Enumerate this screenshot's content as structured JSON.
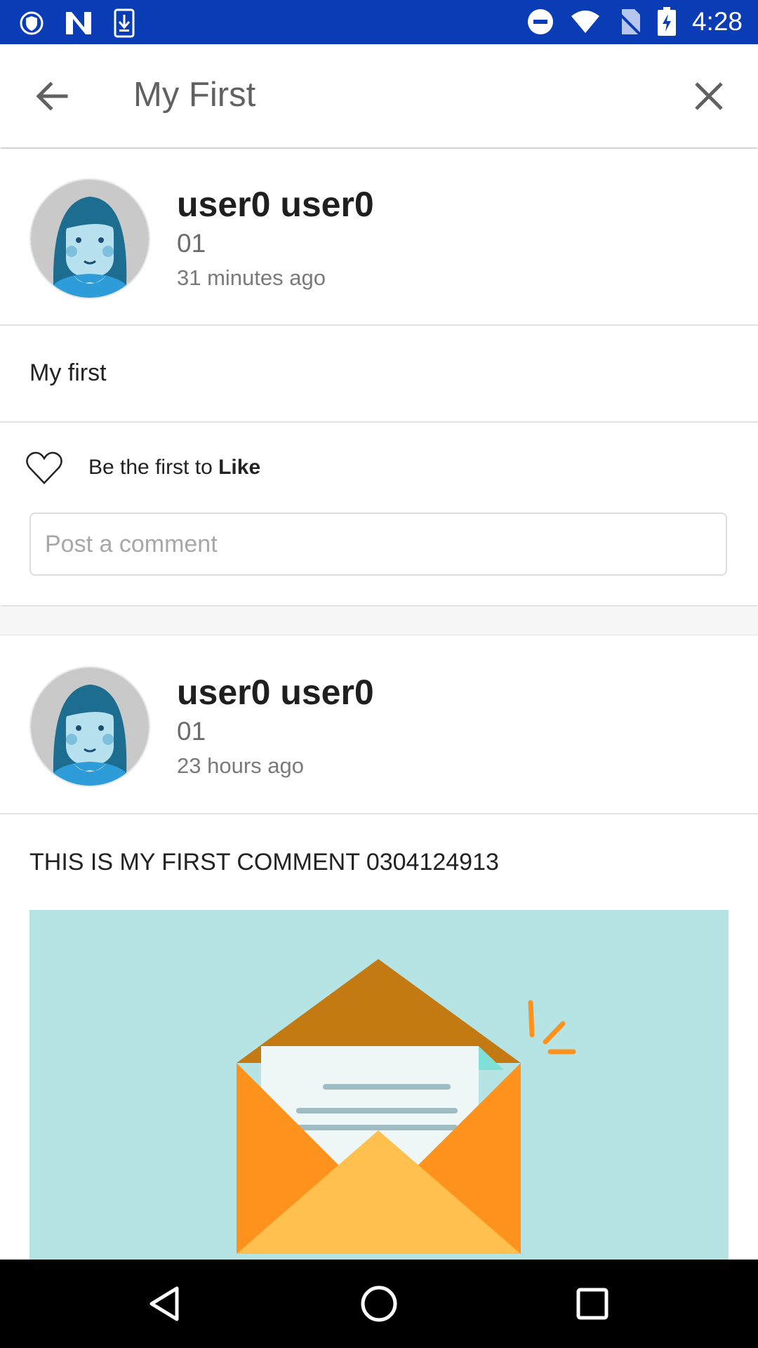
{
  "status_bar": {
    "time": "4:28",
    "icons": [
      "shield-icon",
      "n-notification-icon",
      "download-icon",
      "do-not-disturb-icon",
      "wifi-icon",
      "no-sim-icon",
      "battery-charging-icon"
    ]
  },
  "app_bar": {
    "title": "My First",
    "back_icon": "arrow-back-icon",
    "close_icon": "close-icon"
  },
  "post": {
    "author": "user0 user0",
    "subtitle": "01",
    "time": "31 minutes ago",
    "text": "My first",
    "like_prefix": "Be the first to ",
    "like_bold": "Like",
    "comment_placeholder": "Post a comment"
  },
  "comment": {
    "author": "user0 user0",
    "subtitle": "01",
    "time": "23 hours ago",
    "text": "THIS IS MY FIRST COMMENT 0304124913",
    "image": "envelope-illustration"
  },
  "colors": {
    "status_bar": "#0a3db5",
    "image_bg": "#b6e3e3",
    "envelope": "#ff921c"
  },
  "nav_bar": {
    "icons": [
      "back-triangle-icon",
      "home-circle-icon",
      "recents-square-icon"
    ]
  }
}
